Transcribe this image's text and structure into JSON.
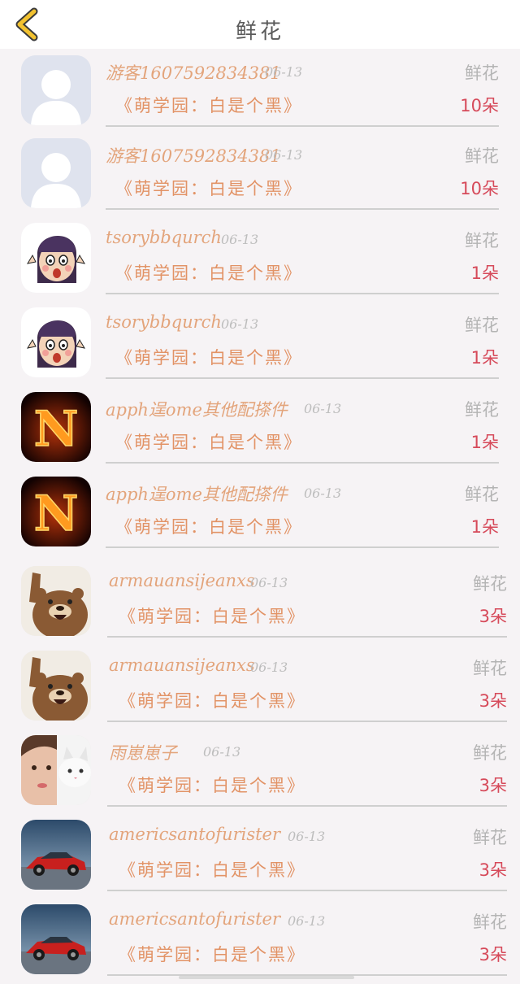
{
  "header": {
    "title": "鲜花",
    "back_icon": "chevron-left-icon",
    "accent": "#f2c230"
  },
  "rows": [
    {
      "name": "游客1607592834381",
      "date": "06-13",
      "kind": "鲜花",
      "book": "《萌学园：白是个黑》",
      "count": "10朵",
      "avatar": "default-person"
    },
    {
      "name": "游客1607592834381",
      "date": "06-13",
      "kind": "鲜花",
      "book": "《萌学园：白是个黑》",
      "count": "10朵",
      "avatar": "default-person"
    },
    {
      "name": "tsorybbqurch",
      "date": "06-13",
      "kind": "鲜花",
      "book": "《萌学园：白是个黑》",
      "count": "1朵",
      "avatar": "cartoon-girl"
    },
    {
      "name": "tsorybbqurch",
      "date": "06-13",
      "kind": "鲜花",
      "book": "《萌学园：白是个黑》",
      "count": "1朵",
      "avatar": "cartoon-girl"
    },
    {
      "name": "apph逞ome其他配搽件",
      "date": "06-13",
      "kind": "鲜花",
      "book": "《萌学园：白是个黑》",
      "count": "1朵",
      "avatar": "flame-letter-n"
    },
    {
      "name": "apph逞ome其他配搽件",
      "date": "06-13",
      "kind": "鲜花",
      "book": "《萌学园：白是个黑》",
      "count": "1朵",
      "avatar": "flame-letter-n"
    },
    {
      "name": "armauansijeanxs",
      "date": "06-13",
      "kind": "鲜花",
      "book": "《萌学园：白是个黑》",
      "count": "3朵",
      "avatar": "brown-bear"
    },
    {
      "name": "armauansijeanxs",
      "date": "06-13",
      "kind": "鲜花",
      "book": "《萌学园：白是个黑》",
      "count": "3朵",
      "avatar": "brown-bear"
    },
    {
      "name": "雨崽崽子",
      "date": "06-13",
      "kind": "鲜花",
      "book": "《萌学园：白是个黑》",
      "count": "3朵",
      "avatar": "girl-with-cat"
    },
    {
      "name": "americsantofurister",
      "date": "06-13",
      "kind": "鲜花",
      "book": "《萌学园：白是个黑》",
      "count": "3朵",
      "avatar": "red-car"
    },
    {
      "name": "americsantofurister",
      "date": "06-13",
      "kind": "鲜花",
      "book": "《萌学园：白是个黑》",
      "count": "3朵",
      "avatar": "red-car"
    }
  ]
}
